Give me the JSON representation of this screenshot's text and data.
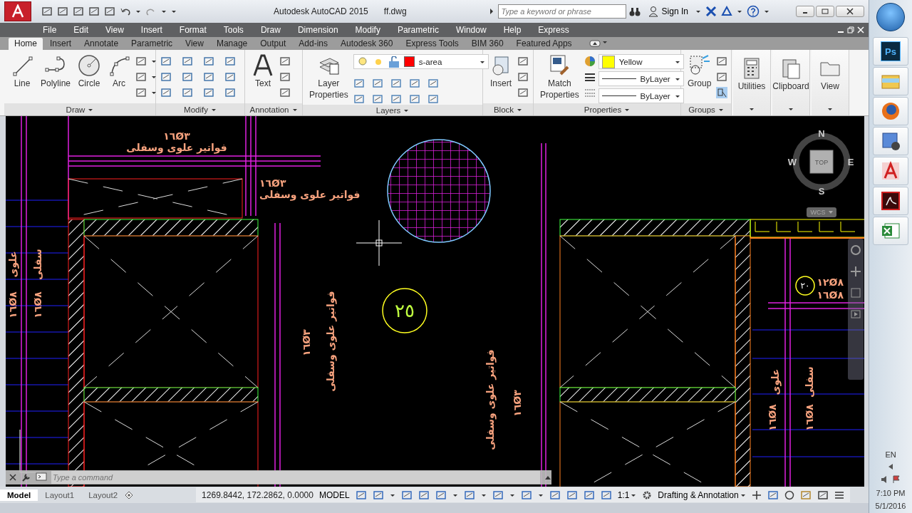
{
  "title_bar": {
    "app": "Autodesk AutoCAD 2015",
    "file": "ff.dwg",
    "search": {
      "placeholder": "Type a keyword or phrase"
    },
    "sign_in": "Sign In"
  },
  "menu_bar": [
    "File",
    "Edit",
    "View",
    "Insert",
    "Format",
    "Tools",
    "Draw",
    "Dimension",
    "Modify",
    "Parametric",
    "Window",
    "Help",
    "Express"
  ],
  "ribbon_tabs": [
    {
      "label": "Home",
      "selected": true
    },
    {
      "label": "Insert",
      "selected": false
    },
    {
      "label": "Annotate",
      "selected": false
    },
    {
      "label": "Parametric",
      "selected": false
    },
    {
      "label": "View",
      "selected": false
    },
    {
      "label": "Manage",
      "selected": false
    },
    {
      "label": "Output",
      "selected": false
    },
    {
      "label": "Add-ins",
      "selected": false
    },
    {
      "label": "Autodesk 360",
      "selected": false
    },
    {
      "label": "Express Tools",
      "selected": false
    },
    {
      "label": "BIM 360",
      "selected": false
    },
    {
      "label": "Featured Apps",
      "selected": false
    }
  ],
  "ribbon_panels": [
    {
      "kind": "draw",
      "title": "Draw",
      "tools": [
        "Line",
        "Polyline",
        "Circle",
        "Arc"
      ]
    },
    {
      "kind": "modify",
      "title": "Modify"
    },
    {
      "kind": "annotation",
      "title": "Annotation",
      "tool": "Text"
    },
    {
      "kind": "layers",
      "title": "Layers",
      "tool": "Layer Properties",
      "layer": "s-area",
      "color": "#ff0000"
    },
    {
      "kind": "block",
      "title": "Block",
      "tool": "Insert"
    },
    {
      "kind": "properties",
      "title": "Properties",
      "tool": "Match Properties",
      "color_name": "Yellow",
      "color": "#ffff00",
      "linetype": "ByLayer",
      "lineweight": "ByLayer"
    },
    {
      "kind": "groups",
      "title": "Groups",
      "tool": "Group"
    },
    {
      "kind": "big",
      "tool": "Utilities"
    },
    {
      "kind": "big",
      "tool": "Clipboard"
    },
    {
      "kind": "big",
      "tool": "View"
    }
  ],
  "drawing": {
    "labels": [
      "١٦Ø٣",
      "فواتير علوى وسفلى",
      "١٦Ø٣",
      "فواتير علوى وسفلى",
      "علوى",
      "سفلى",
      "١٦Ø٨",
      "١٦Ø٨",
      "فواتير علوى وسفلى",
      "١٦Ø٣",
      "فواتير علوى وسفلى",
      "١٦Ø٣",
      "١٢Ø٨",
      "١٦Ø٨",
      "علوى",
      "سفلى",
      "١٦Ø٨",
      "١٦Ø٨"
    ],
    "tags": [
      "٢٥",
      "٢٠"
    ]
  },
  "compass": {
    "north": "N",
    "west": "W",
    "east": "E",
    "south": "S",
    "view": "TOP",
    "ucs": "WCS"
  },
  "command_line": {
    "placeholder": "Type a command"
  },
  "layout_tabs": [
    {
      "label": "Model",
      "selected": true
    },
    {
      "label": "Layout1",
      "selected": false
    },
    {
      "label": "Layout2",
      "selected": false
    }
  ],
  "status_bar": {
    "coordinates": "1269.8442, 172.2862, 0.0000",
    "space": "MODEL",
    "scale": "1:1",
    "workspace": "Drafting & Annotation"
  },
  "taskbar": {
    "apps": [
      {
        "kind": "photoshop",
        "label": "Ps"
      },
      {
        "kind": "explorer"
      },
      {
        "kind": "firefox"
      },
      {
        "kind": "video"
      },
      {
        "kind": "autocad"
      },
      {
        "kind": "acrobat"
      },
      {
        "kind": "excel"
      }
    ],
    "language": "EN",
    "time": "7:10 PM",
    "date": "5/1/2016"
  }
}
